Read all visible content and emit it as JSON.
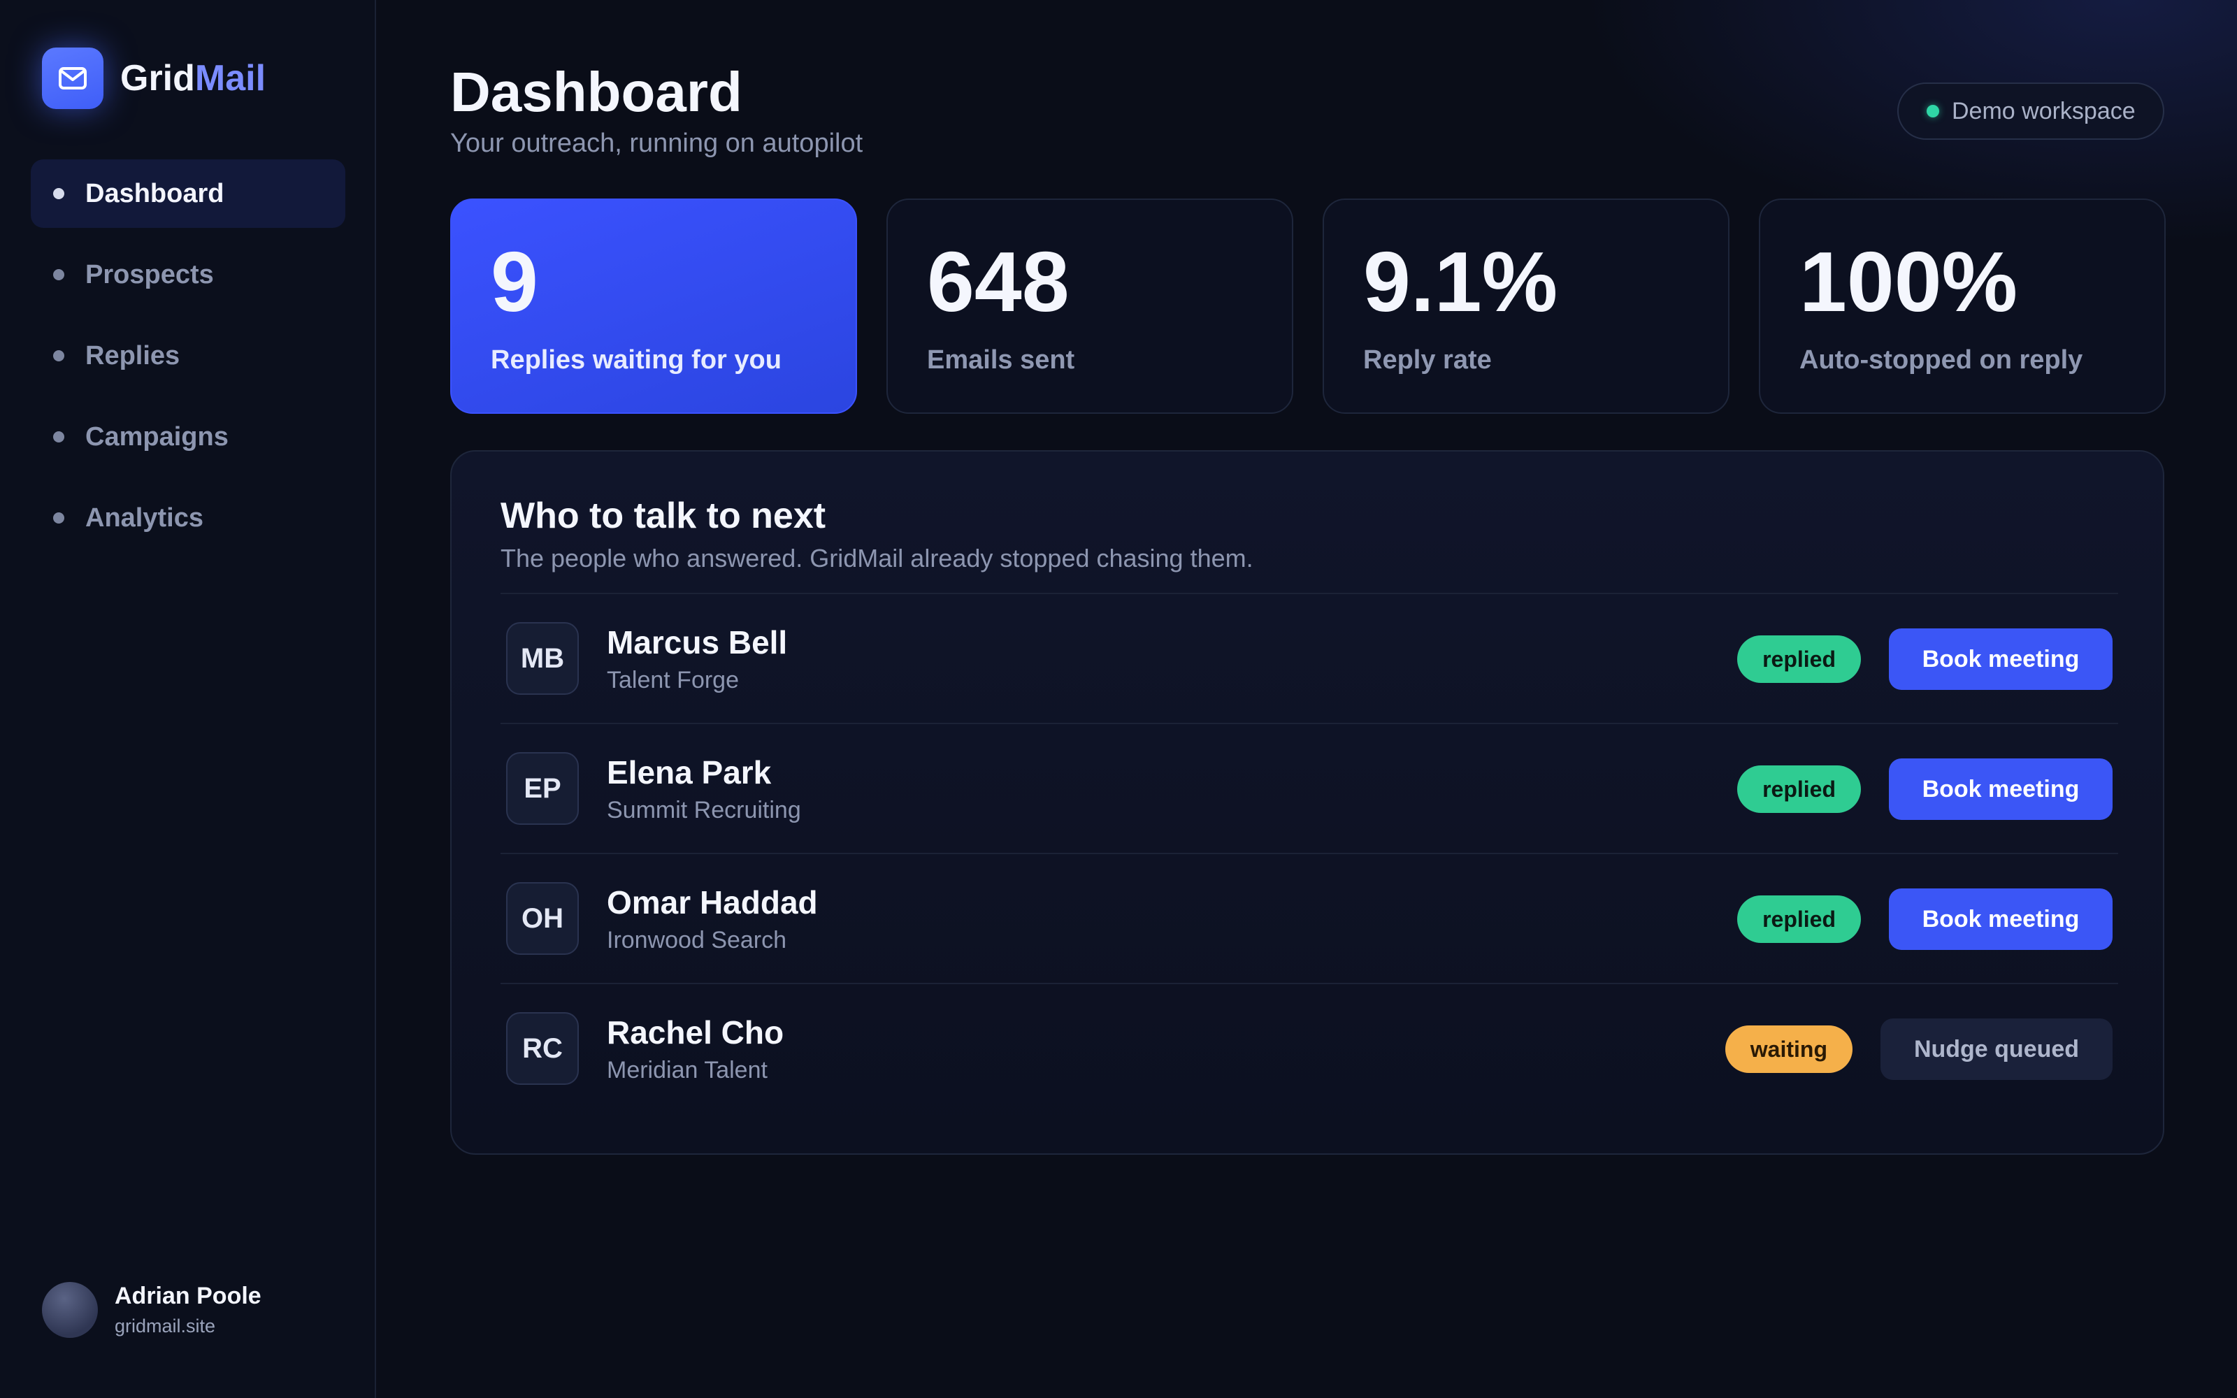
{
  "brand": {
    "name_part1": "Grid",
    "name_part2": "Mail",
    "logo_icon": "mail-icon",
    "accent_color": "#7b8cff"
  },
  "sidebar": {
    "items": [
      {
        "label": "Dashboard",
        "active": true
      },
      {
        "label": "Prospects",
        "active": false
      },
      {
        "label": "Replies",
        "active": false
      },
      {
        "label": "Campaigns",
        "active": false
      },
      {
        "label": "Analytics",
        "active": false
      }
    ],
    "user": {
      "name": "Adrian Poole",
      "site": "gridmail.site"
    }
  },
  "header": {
    "title": "Dashboard",
    "subtitle": "Your outreach, running on autopilot",
    "workspace": "Demo workspace"
  },
  "stats": [
    {
      "value": "9",
      "label": "Replies waiting for you",
      "highlight": true
    },
    {
      "value": "648",
      "label": "Emails sent",
      "highlight": false
    },
    {
      "value": "9.1%",
      "label": "Reply rate",
      "highlight": false
    },
    {
      "value": "100%",
      "label": "Auto-stopped on reply",
      "highlight": false
    }
  ],
  "panel": {
    "title": "Who to talk to next",
    "subtitle": "The people who answered. GridMail already stopped chasing them.",
    "rows": [
      {
        "initials": "MB",
        "name": "Marcus Bell",
        "company": "Talent Forge",
        "status": "replied",
        "action": "Book meeting"
      },
      {
        "initials": "EP",
        "name": "Elena Park",
        "company": "Summit Recruiting",
        "status": "replied",
        "action": "Book meeting"
      },
      {
        "initials": "OH",
        "name": "Omar Haddad",
        "company": "Ironwood Search",
        "status": "replied",
        "action": "Book meeting"
      },
      {
        "initials": "RC",
        "name": "Rachel Cho",
        "company": "Meridian Talent",
        "status": "waiting",
        "action": "Nudge queued"
      }
    ]
  },
  "colors": {
    "primary": "#3b56f6",
    "replied": "#2fcc92",
    "waiting": "#f5b04a",
    "online": "#2fd6a6"
  }
}
